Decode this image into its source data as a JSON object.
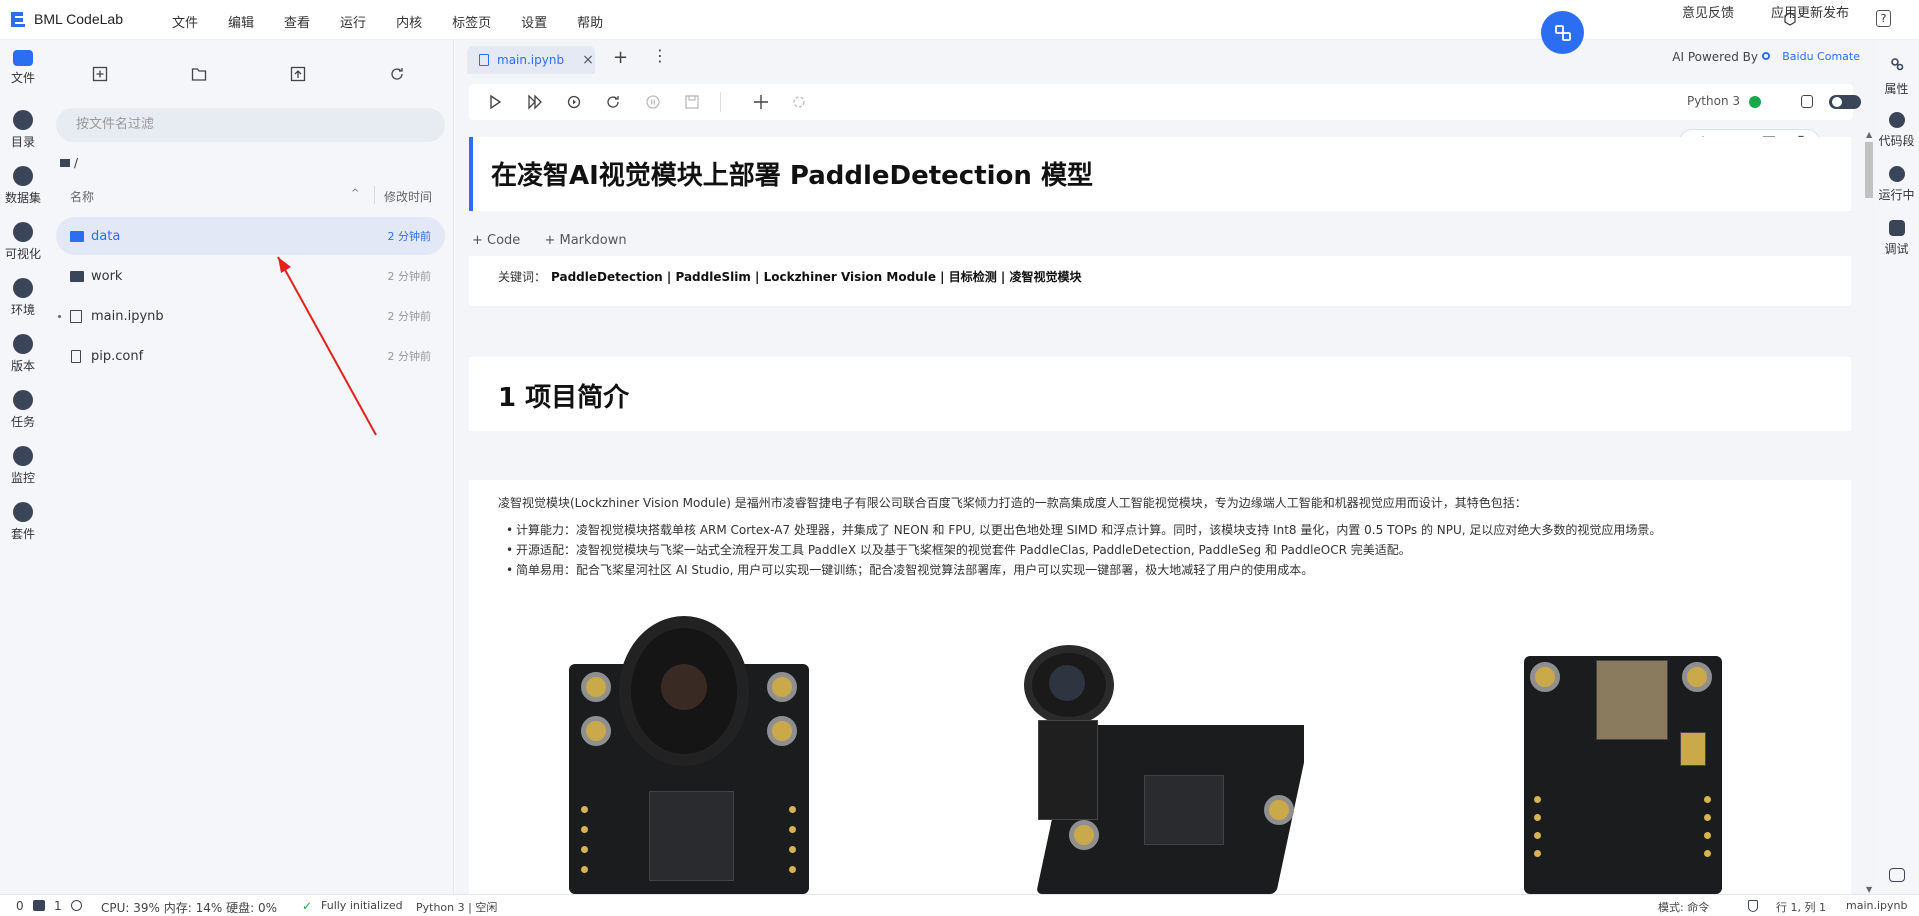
{
  "app": {
    "name": "BML CodeLab"
  },
  "menu": [
    "文件",
    "编辑",
    "查看",
    "运行",
    "内核",
    "标签页",
    "设置",
    "帮助"
  ],
  "top_right": {
    "feedback": "意见反馈",
    "update": "应用更新发布",
    "help": "?"
  },
  "ai_powered": {
    "label": "AI Powered By",
    "brand": "Baidu Comate"
  },
  "left_rail": [
    "文件",
    "目录",
    "数据集",
    "可视化",
    "环境",
    "版本",
    "任务",
    "监控",
    "套件"
  ],
  "file_panel": {
    "search_placeholder": "按文件名过滤",
    "path": "/",
    "col_name": "名称",
    "col_time": "修改时间",
    "files": [
      {
        "name": "data",
        "time": "2 分钟前",
        "icon": "folder-icon"
      },
      {
        "name": "work",
        "time": "2 分钟前",
        "icon": "folder-icon"
      },
      {
        "name": "main.ipynb",
        "time": "2 分钟前",
        "icon": "notebook-icon"
      },
      {
        "name": "pip.conf",
        "time": "2 分钟前",
        "icon": "file-icon"
      }
    ]
  },
  "tab": {
    "name": "main.ipynb"
  },
  "kernel": {
    "name": "Python 3",
    "status_color": "#1aa84a"
  },
  "add_cell": {
    "code": "+ Code",
    "markdown": "+ Markdown"
  },
  "notebook": {
    "title": "在凌智AI视觉模块上部署 PaddleDetection 模型",
    "keywords_label": "关键词：",
    "keywords": "PaddleDetection | PaddleSlim | Lockzhiner Vision Module | 目标检测 | 凌智视觉模块",
    "section_heading": "1 项目简介",
    "intro": "凌智视觉模块(Lockzhiner Vision Module) 是福州市凌睿智捷电子有限公司联合百度飞桨倾力打造的一款高集成度人工智能视觉模块，专为边缘端人工智能和机器视觉应用而设计，其特色包括：",
    "bullets": [
      "计算能力：凌智视觉模块搭载单核 ARM Cortex-A7 处理器，并集成了 NEON 和 FPU, 以更出色地处理 SIMD 和浮点计算。同时，该模块支持 Int8 量化，内置 0.5 TOPs 的 NPU, 足以应对绝大多数的视觉应用场景。",
      "开源适配：凌智视觉模块与飞桨一站式全流程开发工具 PaddleX 以及基于飞桨框架的视觉套件 PaddleClas, PaddleDetection, PaddleSeg 和 PaddleOCR 完美适配。",
      "简单易用：配合飞桨星河社区 AI Studio, 用户可以实现一键训练；配合凌智视觉算法部署库，用户可以实现一键部署，极大地减轻了用户的使用成本。"
    ]
  },
  "right_rail": [
    "属性",
    "代码段",
    "运行中",
    "调试"
  ],
  "status": {
    "left_counts": "0",
    "terminals": "1",
    "resources": "CPU: 39% 内存: 14% 硬盘: 0%",
    "init": "Fully initialized",
    "kernel_state": "Python 3 | 空闲",
    "mode": "模式: 命令",
    "cursor": "行 1, 列 1",
    "file": "main.ipynb"
  }
}
